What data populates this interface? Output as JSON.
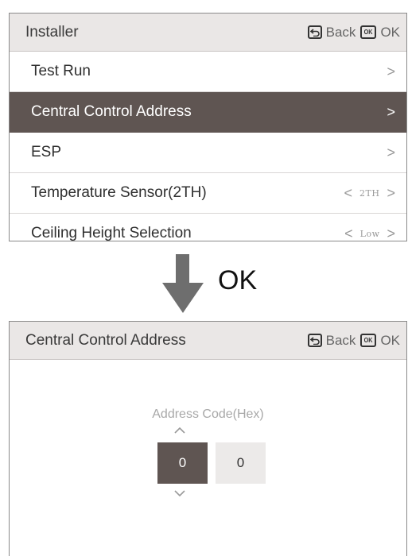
{
  "screen1": {
    "title": "Installer",
    "back_label": "Back",
    "ok_label": "OK",
    "ok_key_text": "OK",
    "menu": [
      {
        "label": "Test Run",
        "chevron": ">"
      },
      {
        "label": "Central Control Address",
        "chevron": ">",
        "selected": true
      },
      {
        "label": "ESP",
        "chevron": ">"
      },
      {
        "label": "Temperature Sensor(2TH)",
        "left": "<",
        "value": "2TH",
        "right": ">"
      },
      {
        "label": "Ceiling Height Selection",
        "left": "<",
        "value": "Low",
        "right": ">"
      }
    ]
  },
  "transition": {
    "label": "OK"
  },
  "screen2": {
    "title": "Central Control Address",
    "back_label": "Back",
    "ok_label": "OK",
    "ok_key_text": "OK",
    "address_label": "Address Code(Hex)",
    "digits": [
      "0",
      "0"
    ]
  },
  "colors": {
    "header_bg": "#eae7e6",
    "selected_bg": "#5f5552",
    "arrow": "#6e6e6e"
  },
  "icons": {
    "back": "back-return-icon",
    "ok": "ok-key-icon",
    "up": "chevron-up-icon",
    "down": "chevron-down-icon"
  }
}
